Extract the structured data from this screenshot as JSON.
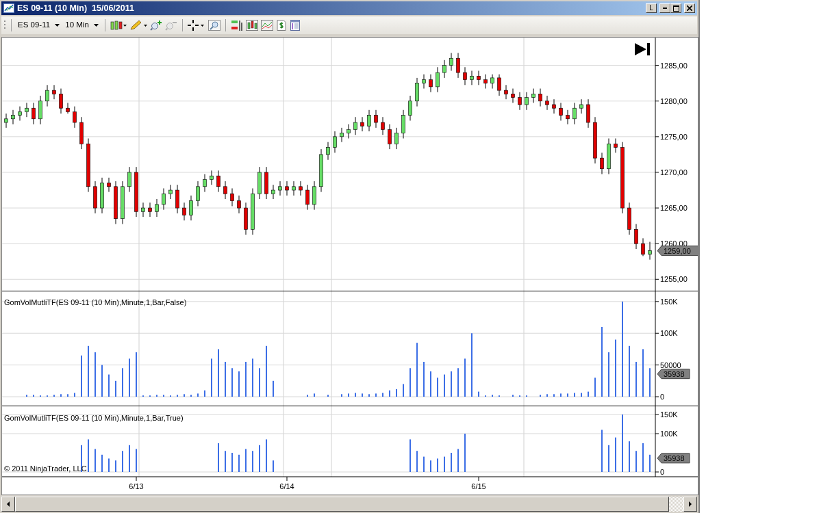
{
  "window": {
    "title": "ES 09-11 (10 Min)  15/06/2011",
    "link_button": "L"
  },
  "toolbar": {
    "instrument": "ES 09-11",
    "period": "10 Min"
  },
  "price_panel": {
    "last_price": "1259,00",
    "chart_data": {
      "type": "candlestick",
      "grid": true,
      "categories": [
        null,
        null,
        null,
        null,
        null,
        null,
        null,
        null,
        null,
        null,
        null,
        null,
        null,
        null,
        null,
        null,
        null,
        null,
        null,
        null,
        null,
        null,
        null,
        null,
        null,
        null,
        null,
        null,
        null,
        null,
        null,
        null,
        null,
        null,
        null,
        null,
        null,
        null,
        null,
        null,
        null,
        null,
        null,
        null,
        null,
        null,
        null,
        null,
        null,
        null,
        null,
        null,
        null,
        null,
        null,
        null,
        null,
        null,
        null,
        null,
        null,
        null,
        null,
        null,
        null,
        null,
        null,
        null,
        null,
        null,
        null,
        null,
        null,
        null,
        null,
        null,
        null,
        null,
        null,
        null,
        null,
        null,
        null,
        null,
        null,
        null,
        null,
        null,
        null,
        null,
        null,
        null,
        null,
        null,
        null
      ],
      "ylim": [
        1253.3,
        1288.9
      ],
      "yticks": [
        {
          "value": 1255,
          "label": "1255,00"
        },
        {
          "value": 1260,
          "label": "1260,00"
        },
        {
          "value": 1265,
          "label": "1265,00"
        },
        {
          "value": 1270,
          "label": "1270,00"
        },
        {
          "value": 1275,
          "label": "1275,00"
        },
        {
          "value": 1280,
          "label": "1280,00"
        },
        {
          "value": 1285,
          "label": "1285,00"
        }
      ],
      "ohlc": [
        [
          1277,
          1278.25,
          1276.25,
          1277.5
        ],
        [
          1277.5,
          1278.75,
          1276.75,
          1278
        ],
        [
          1278,
          1279.25,
          1277.25,
          1278.5
        ],
        [
          1278.5,
          1279.75,
          1277.75,
          1279
        ],
        [
          1279,
          1279.75,
          1276.75,
          1277.5
        ],
        [
          1277.5,
          1280.75,
          1276.75,
          1280
        ],
        [
          1280,
          1282.25,
          1279.25,
          1281.5
        ],
        [
          1281.5,
          1282.25,
          1280.25,
          1281
        ],
        [
          1281,
          1281.75,
          1278.25,
          1279
        ],
        [
          1279,
          1279.75,
          1278.25,
          1278.5
        ],
        [
          1278.5,
          1279.25,
          1276.25,
          1277
        ],
        [
          1277,
          1277.75,
          1273.25,
          1274
        ],
        [
          1274,
          1274.75,
          1267.25,
          1268
        ],
        [
          1268,
          1268.75,
          1264.25,
          1265
        ],
        [
          1265,
          1269.25,
          1264.25,
          1268.5
        ],
        [
          1268.5,
          1269.25,
          1267.25,
          1268
        ],
        [
          1268,
          1268.75,
          1262.75,
          1263.5
        ],
        [
          1263.5,
          1268.75,
          1262.75,
          1268
        ],
        [
          1268,
          1270.75,
          1267.25,
          1270
        ],
        [
          1270,
          1270.75,
          1263.75,
          1264.5
        ],
        [
          1264.5,
          1265.75,
          1263.75,
          1265
        ],
        [
          1265,
          1265.75,
          1263.75,
          1264.5
        ],
        [
          1264.5,
          1266.25,
          1263.75,
          1265.5
        ],
        [
          1265.5,
          1267.75,
          1264.75,
          1267
        ],
        [
          1267,
          1268.25,
          1266.25,
          1267.5
        ],
        [
          1267.5,
          1268.25,
          1264.25,
          1265
        ],
        [
          1265,
          1265.75,
          1263.25,
          1264
        ],
        [
          1264,
          1266.75,
          1263.25,
          1266
        ],
        [
          1266,
          1268.75,
          1265.25,
          1268
        ],
        [
          1268,
          1269.75,
          1267.25,
          1269
        ],
        [
          1269,
          1270.25,
          1268.25,
          1269.5
        ],
        [
          1269.5,
          1270.25,
          1267.25,
          1268
        ],
        [
          1268,
          1268.75,
          1266.25,
          1267
        ],
        [
          1267,
          1267.75,
          1265.25,
          1266
        ],
        [
          1266,
          1266.75,
          1264.25,
          1265
        ],
        [
          1265,
          1265.75,
          1261.25,
          1262
        ],
        [
          1262,
          1267.75,
          1261.25,
          1267
        ],
        [
          1267,
          1270.75,
          1266.25,
          1270
        ],
        [
          1270,
          1270.75,
          1266.25,
          1267
        ],
        [
          1267,
          1268.25,
          1266.25,
          1267.5
        ],
        [
          1267.5,
          1268.75,
          1266.75,
          1268
        ],
        [
          1268,
          1268.75,
          1266.75,
          1267.5
        ],
        [
          1267.5,
          1268.75,
          1266.75,
          1268
        ],
        [
          1268,
          1268.75,
          1266.75,
          1267.5
        ],
        [
          1267.5,
          1268.25,
          1264.75,
          1265.5
        ],
        [
          1265.5,
          1268.75,
          1264.75,
          1268
        ],
        [
          1268,
          1273.25,
          1267.25,
          1272.5
        ],
        [
          1272.5,
          1274.25,
          1271.75,
          1273.5
        ],
        [
          1273.5,
          1275.75,
          1272.75,
          1275
        ],
        [
          1275,
          1276.25,
          1274.25,
          1275.5
        ],
        [
          1275.5,
          1276.75,
          1274.75,
          1276
        ],
        [
          1276,
          1277.75,
          1275.25,
          1277
        ],
        [
          1277,
          1277.75,
          1275.75,
          1276.5
        ],
        [
          1276.5,
          1278.75,
          1275.75,
          1278
        ],
        [
          1278,
          1278.75,
          1276.25,
          1277
        ],
        [
          1277,
          1277.75,
          1275.25,
          1276
        ],
        [
          1276,
          1276.75,
          1273.25,
          1274
        ],
        [
          1274,
          1276.25,
          1273.25,
          1275.5
        ],
        [
          1275.5,
          1278.75,
          1274.75,
          1278
        ],
        [
          1278,
          1280.75,
          1277.25,
          1280
        ],
        [
          1280,
          1283.25,
          1279.25,
          1282.5
        ],
        [
          1282.5,
          1283.75,
          1281.75,
          1283
        ],
        [
          1283,
          1283.75,
          1281.25,
          1282
        ],
        [
          1282,
          1284.75,
          1281.25,
          1284
        ],
        [
          1284,
          1285.75,
          1283.25,
          1285
        ],
        [
          1285,
          1286.75,
          1284.25,
          1286
        ],
        [
          1286,
          1286.75,
          1283.25,
          1284
        ],
        [
          1284,
          1284.75,
          1282.25,
          1283
        ],
        [
          1283,
          1284.25,
          1282.25,
          1283.5
        ],
        [
          1283.5,
          1284.25,
          1282.25,
          1283
        ],
        [
          1283,
          1283.75,
          1281.75,
          1282.5
        ],
        [
          1282.5,
          1283.75,
          1281.75,
          1283.25
        ],
        [
          1283.25,
          1283.75,
          1280.75,
          1281.5
        ],
        [
          1281.5,
          1282.25,
          1280.25,
          1281
        ],
        [
          1281,
          1281.75,
          1279.75,
          1280.5
        ],
        [
          1280.5,
          1281.25,
          1278.75,
          1279.5
        ],
        [
          1279.5,
          1281.25,
          1278.75,
          1280.5
        ],
        [
          1280.5,
          1281.75,
          1279.75,
          1281
        ],
        [
          1281,
          1281.75,
          1279.25,
          1280
        ],
        [
          1280,
          1280.75,
          1278.75,
          1279.5
        ],
        [
          1279.5,
          1280.25,
          1278.25,
          1279
        ],
        [
          1279,
          1279.75,
          1277.25,
          1278
        ],
        [
          1278,
          1278.75,
          1276.75,
          1277.5
        ],
        [
          1277.5,
          1279.75,
          1276.75,
          1279
        ],
        [
          1279,
          1280.25,
          1278.25,
          1279.5
        ],
        [
          1279.5,
          1280.25,
          1276.25,
          1277
        ],
        [
          1277,
          1277.75,
          1271.25,
          1272
        ],
        [
          1272,
          1272.75,
          1269.75,
          1270.5
        ],
        [
          1270.5,
          1274.75,
          1269.75,
          1274
        ],
        [
          1274,
          1274.75,
          1272.75,
          1273.5
        ],
        [
          1273.5,
          1274.25,
          1264.25,
          1265
        ],
        [
          1265,
          1265.75,
          1261.25,
          1262
        ],
        [
          1262,
          1262.75,
          1259.25,
          1260
        ],
        [
          1260,
          1260.75,
          1258.25,
          1258.5
        ],
        [
          1258.5,
          1260.25,
          1257.75,
          1259
        ]
      ]
    }
  },
  "volume_panels": [
    {
      "title": "GomVolMutliTF(ES 09-11  (10 Min),Minute,1,Bar,False)",
      "last_value": "35938",
      "chart_data": {
        "type": "bar",
        "grid": true,
        "categories": [
          null,
          null,
          null,
          null,
          null,
          null,
          null,
          null,
          null,
          null,
          null,
          null,
          null,
          null,
          null,
          null,
          null,
          null,
          null,
          null,
          null,
          null,
          null,
          null,
          null,
          null,
          null,
          null,
          null,
          null,
          null,
          null,
          null,
          null,
          null,
          null,
          null,
          null,
          null,
          null,
          null,
          null,
          null,
          null,
          null,
          null,
          null,
          null,
          null,
          null,
          null,
          null,
          null,
          null,
          null,
          null,
          null,
          null,
          null,
          null,
          null,
          null,
          null,
          null,
          null,
          null,
          null,
          null,
          null,
          null,
          null,
          null,
          null,
          null,
          null,
          null,
          null,
          null,
          null,
          null,
          null,
          null,
          null,
          null,
          null,
          null,
          null,
          null,
          null,
          null,
          null,
          null,
          null,
          null,
          null
        ],
        "ylim": [
          0,
          166000
        ],
        "yticks": [
          {
            "value": 0,
            "label": "0"
          },
          {
            "value": 50000,
            "label": "50000"
          },
          {
            "value": 100000,
            "label": "100K"
          },
          {
            "value": 150000,
            "label": "150K"
          }
        ],
        "series": [
          {
            "color": "#3c6ee6",
            "values": [
              null,
              null,
              null,
              3000,
              3000,
              2000,
              2000,
              3000,
              4000,
              4000,
              6000,
              65000,
              80000,
              70000,
              50000,
              35000,
              25000,
              45000,
              60000,
              70000,
              2000,
              2000,
              3000,
              3000,
              2000,
              3000,
              4000,
              3000,
              5000,
              10000,
              60000,
              75000,
              55000,
              45000,
              40000,
              55000,
              60000,
              45000,
              80000,
              25000,
              null,
              null,
              null,
              null,
              3000,
              5000,
              null,
              3000,
              null,
              4000,
              5000,
              6000,
              5000,
              4000,
              5000,
              6000,
              10000,
              12000,
              20000,
              45000,
              85000,
              55000,
              40000,
              30000,
              35000,
              40000,
              45000,
              60000,
              100000,
              8000,
              2000,
              3000,
              2000,
              null,
              3000,
              2000,
              2000,
              null,
              3000,
              4000,
              4000,
              5000,
              5000,
              6000,
              6000,
              8000,
              30000,
              110000,
              70000,
              90000,
              150000,
              80000,
              55000,
              75000,
              45000
            ]
          }
        ]
      }
    },
    {
      "title": "GomVolMutliTF(ES 09-11  (10 Min),Minute,1,Bar,True)",
      "last_value": "35938",
      "chart_data": {
        "type": "bar",
        "grid": true,
        "ylim": [
          0,
          171400
        ],
        "yticks": [
          {
            "value": 0,
            "label": "0"
          },
          {
            "value": 100000,
            "label": "100K"
          },
          {
            "value": 150000,
            "label": "150K"
          }
        ],
        "categories": [
          null,
          null,
          null,
          null,
          null,
          null,
          null,
          null,
          null,
          null,
          null,
          null,
          null,
          null,
          null,
          null,
          null,
          null,
          null,
          "6/13",
          null,
          null,
          null,
          null,
          null,
          null,
          null,
          null,
          null,
          null,
          null,
          null,
          null,
          null,
          null,
          null,
          null,
          null,
          null,
          null,
          null,
          "6/14",
          null,
          null,
          null,
          null,
          null,
          null,
          null,
          null,
          null,
          null,
          null,
          null,
          null,
          null,
          null,
          null,
          null,
          null,
          null,
          null,
          null,
          null,
          null,
          null,
          null,
          null,
          null,
          "6/15",
          null,
          null,
          null,
          null,
          null,
          null,
          null,
          null,
          null,
          null,
          null,
          null,
          null,
          null,
          null,
          null,
          null,
          null,
          null,
          null,
          null,
          null,
          null,
          null,
          null
        ],
        "series": [
          {
            "color": "#3c6ee6",
            "values": [
              null,
              null,
              null,
              null,
              null,
              null,
              null,
              null,
              null,
              null,
              null,
              70000,
              85000,
              60000,
              45000,
              35000,
              30000,
              55000,
              70000,
              60000,
              null,
              null,
              null,
              null,
              null,
              null,
              null,
              null,
              null,
              null,
              null,
              75000,
              55000,
              50000,
              45000,
              60000,
              55000,
              70000,
              85000,
              30000,
              null,
              null,
              null,
              null,
              null,
              null,
              null,
              null,
              null,
              null,
              null,
              null,
              null,
              null,
              null,
              null,
              null,
              null,
              null,
              85000,
              55000,
              40000,
              30000,
              35000,
              40000,
              50000,
              60000,
              100000,
              null,
              null,
              null,
              null,
              null,
              null,
              null,
              null,
              null,
              null,
              null,
              null,
              null,
              null,
              null,
              null,
              null,
              null,
              null,
              110000,
              70000,
              90000,
              150000,
              80000,
              55000,
              75000,
              45000
            ]
          }
        ]
      }
    }
  ],
  "copyright": "© 2011 NinjaTrader, LLC"
}
